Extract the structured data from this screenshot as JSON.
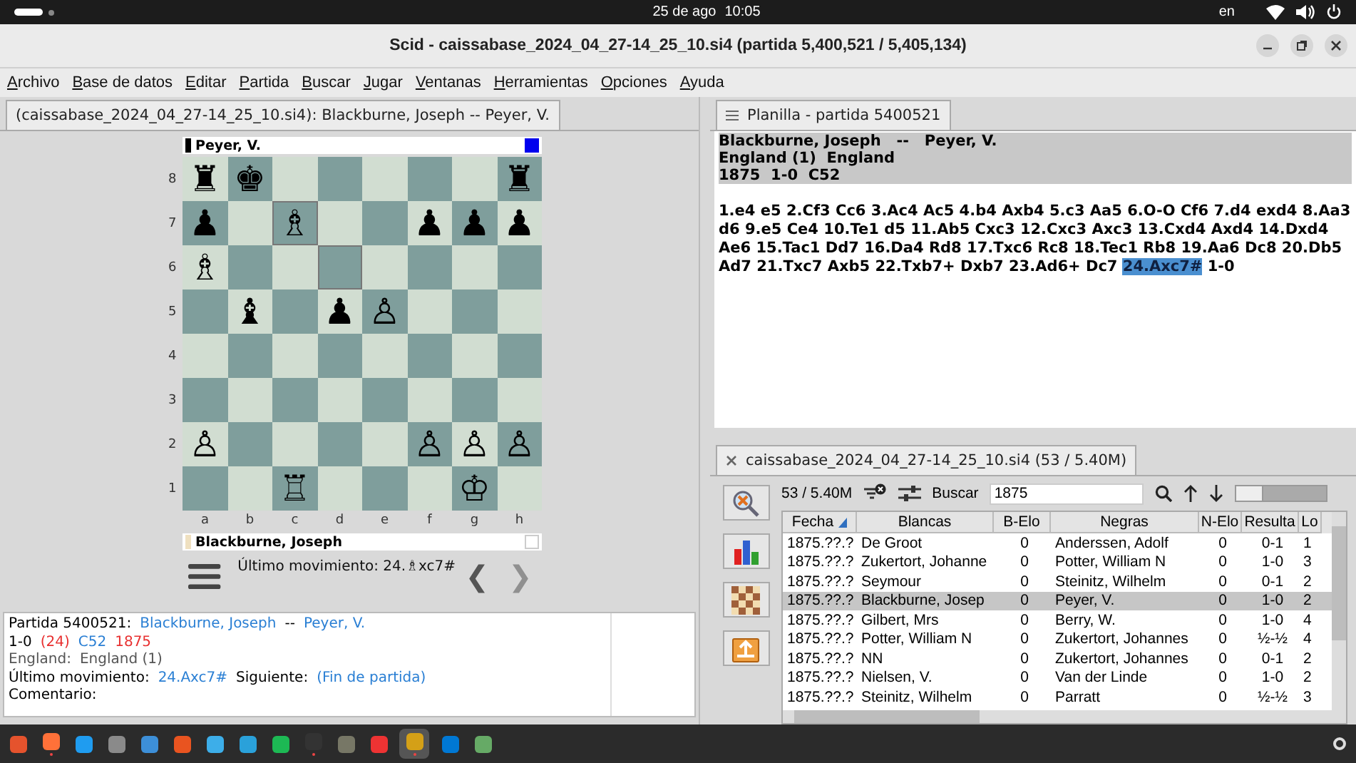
{
  "system_bar": {
    "date": "25 de ago",
    "time": "10:05",
    "language": "en"
  },
  "window": {
    "title": "Scid - caissabase_2024_04_27-14_25_10.si4 (partida 5,400,521 / 5,405,134)"
  },
  "menu": [
    "Archivo",
    "Base de datos",
    "Editar",
    "Partida",
    "Buscar",
    "Jugar",
    "Ventanas",
    "Herramientas",
    "Opciones",
    "Ayuda"
  ],
  "board_pane": {
    "tab": {
      "label": "(caissabase_2024_04_27-14_25_10.si4): Blackburne, Joseph -- Peyer, V.",
      "selected": true
    },
    "players": [
      {
        "name": "Peyer, V.",
        "color": "#000000",
        "to_move": true
      },
      {
        "name": "Blackburne, Joseph",
        "color": "#efe0c0",
        "to_move": false
      }
    ],
    "ranks": [
      {
        "label": "8",
        "squares": [
          {
            "piece": "♜",
            "highlighted": false
          },
          {
            "piece": "♚",
            "highlighted": false
          },
          {
            "highlighted": false
          },
          {
            "highlighted": false
          },
          {
            "highlighted": false
          },
          {
            "highlighted": false
          },
          {
            "highlighted": false
          },
          {
            "piece": "♜",
            "highlighted": false
          }
        ]
      },
      {
        "label": "7",
        "squares": [
          {
            "piece": "♟",
            "highlighted": false
          },
          {
            "highlighted": false
          },
          {
            "piece": "♗",
            "highlighted": true
          },
          {
            "highlighted": false
          },
          {
            "highlighted": false
          },
          {
            "piece": "♟",
            "highlighted": false
          },
          {
            "piece": "♟",
            "highlighted": false
          },
          {
            "piece": "♟",
            "highlighted": false
          }
        ]
      },
      {
        "label": "6",
        "squares": [
          {
            "piece": "♗",
            "highlighted": false
          },
          {
            "highlighted": false
          },
          {
            "highlighted": false
          },
          {
            "highlighted": true
          },
          {
            "highlighted": false
          },
          {
            "highlighted": false
          },
          {
            "highlighted": false
          },
          {
            "highlighted": false
          }
        ]
      },
      {
        "label": "5",
        "squares": [
          {
            "highlighted": false
          },
          {
            "piece": "♝",
            "highlighted": false
          },
          {
            "highlighted": false
          },
          {
            "piece": "♟",
            "highlighted": false
          },
          {
            "piece": "♙",
            "highlighted": false
          },
          {
            "highlighted": false
          },
          {
            "highlighted": false
          },
          {
            "highlighted": false
          }
        ]
      },
      {
        "label": "4",
        "squares": [
          {
            "highlighted": false
          },
          {
            "highlighted": false
          },
          {
            "highlighted": false
          },
          {
            "highlighted": false
          },
          {
            "highlighted": false
          },
          {
            "highlighted": false
          },
          {
            "highlighted": false
          },
          {
            "highlighted": false
          }
        ]
      },
      {
        "label": "3",
        "squares": [
          {
            "highlighted": false
          },
          {
            "highlighted": false
          },
          {
            "highlighted": false
          },
          {
            "highlighted": false
          },
          {
            "highlighted": false
          },
          {
            "highlighted": false
          },
          {
            "highlighted": false
          },
          {
            "highlighted": false
          }
        ]
      },
      {
        "label": "2",
        "squares": [
          {
            "piece": "♙",
            "highlighted": false
          },
          {
            "highlighted": false
          },
          {
            "highlighted": false
          },
          {
            "highlighted": false
          },
          {
            "highlighted": false
          },
          {
            "piece": "♙",
            "highlighted": false
          },
          {
            "piece": "♙",
            "highlighted": false
          },
          {
            "piece": "♙",
            "highlighted": false
          }
        ]
      },
      {
        "label": "1",
        "squares": [
          {
            "highlighted": false
          },
          {
            "highlighted": false
          },
          {
            "piece": "♖",
            "highlighted": false
          },
          {
            "highlighted": false
          },
          {
            "highlighted": false
          },
          {
            "highlighted": false
          },
          {
            "piece": "♔",
            "highlighted": false
          },
          {
            "highlighted": false
          }
        ]
      }
    ],
    "files": [
      "a",
      "b",
      "c",
      "d",
      "e",
      "f",
      "g",
      "h"
    ],
    "last_move": "Último movimiento: 24.♗xc7#",
    "nav": [
      {
        "symbol": "❮",
        "disabled": false
      },
      {
        "symbol": "❯",
        "disabled": true
      }
    ]
  },
  "game_info": {
    "lines": [
      [
        {
          "text": "Partida 5400521:",
          "kind": "plain"
        },
        {
          "text": "Blackburne, Joseph",
          "kind": "link"
        },
        {
          "text": "--",
          "kind": "plain"
        },
        {
          "text": "Peyer, V.",
          "kind": "link"
        }
      ],
      [
        {
          "text": "1-0",
          "kind": "plain"
        },
        {
          "text": "(24)",
          "kind": "red"
        },
        {
          "text": "C52",
          "kind": "link"
        },
        {
          "text": "1875",
          "kind": "red"
        }
      ],
      [
        {
          "text": "England:",
          "kind": "muted"
        },
        {
          "text": "England (1)",
          "kind": "muted"
        }
      ],
      [
        {
          "text": "Último movimiento:",
          "kind": "plain"
        },
        {
          "text": "24.Axc7#",
          "kind": "link"
        },
        {
          "text": "Siguiente:",
          "kind": "plain"
        },
        {
          "text": "(Fin de partida)",
          "kind": "link"
        }
      ],
      [
        {
          "text": "Comentario:",
          "kind": "plain"
        }
      ]
    ]
  },
  "notation_pane": {
    "tab": {
      "label": "Planilla - partida 5400521",
      "selected": true
    },
    "header": [
      "Blackburne, Joseph   --   Peyer, V.",
      "England (1)  England",
      "1875  1-0  C52"
    ],
    "moves": [
      {
        "text": "1.e4 e5 2.Cf3 Cc6 3.Ac4 Ac5 4.b4 Axb4 5.c3 Aa5 6.O-O Cf6 7.d4 exd4 8.Aa3 d6 9.e5 Ce4 10.Te1 d5 11.Ab5 Cxc3 12.Cxc3 Axc3 13.Cxd4 Axd4 14.Dxd4 Ae6 15.Tac1 Dd7 16.Da4 Rd8 17.Txc6 Rc8 18.Tec1 Rb8 19.Aa6 Dc8 20.Db5 Ad7 21.Txc7 Axb5 22.Txb7+ Dxb7 23.Ad6+ Dc7",
        "current": false
      },
      {
        "text": "24.Axc7#",
        "current": true
      },
      {
        "text": "1-0",
        "current": false
      }
    ]
  },
  "games_pane": {
    "tab": {
      "label": "caissabase_2024_04_27-14_25_10.si4 (53 / 5.40M)",
      "selected": true
    },
    "count": "53 / 5.40M",
    "search": {
      "label": "Buscar",
      "value": "1875"
    },
    "columns": [
      {
        "label": "Fecha",
        "sorted": true
      },
      {
        "label": "Blancas",
        "sorted": false
      },
      {
        "label": "B-Elo",
        "sorted": false
      },
      {
        "label": "Negras",
        "sorted": false
      },
      {
        "label": "N-Elo",
        "sorted": false
      },
      {
        "label": "Resulta",
        "sorted": false
      },
      {
        "label": "Lo",
        "sorted": false
      }
    ],
    "rows": [
      {
        "cells": [
          "1875.??.?",
          "De Groot",
          "0",
          "Anderssen, Adolf",
          "0",
          "0-1",
          "1"
        ],
        "selected": false
      },
      {
        "cells": [
          "1875.??.?",
          "Zukertort, Johanne",
          "0",
          "Potter, William N",
          "0",
          "1-0",
          "3"
        ],
        "selected": false
      },
      {
        "cells": [
          "1875.??.?",
          "Seymour",
          "0",
          "Steinitz, Wilhelm",
          "0",
          "0-1",
          "2"
        ],
        "selected": false
      },
      {
        "cells": [
          "1875.??.?",
          "Blackburne, Josep",
          "0",
          "Peyer, V.",
          "0",
          "1-0",
          "2"
        ],
        "selected": true
      },
      {
        "cells": [
          "1875.??.?",
          "Gilbert, Mrs",
          "0",
          "Berry, W.",
          "0",
          "1-0",
          "4"
        ],
        "selected": false
      },
      {
        "cells": [
          "1875.??.?",
          "Potter, William N",
          "0",
          "Zukertort, Johannes",
          "0",
          "½-½",
          "4"
        ],
        "selected": false
      },
      {
        "cells": [
          "1875.??.?",
          "NN",
          "0",
          "Zukertort, Johannes",
          "0",
          "0-1",
          "2"
        ],
        "selected": false
      },
      {
        "cells": [
          "1875.??.?",
          "Nielsen, V.",
          "0",
          "Van der Linde",
          "0",
          "1-0",
          "2"
        ],
        "selected": false
      },
      {
        "cells": [
          "1875.??.?",
          "Steinitz, Wilhelm",
          "0",
          "Parratt",
          "0",
          "½-½",
          "3"
        ],
        "selected": false
      }
    ]
  },
  "taskbar": {
    "apps": [
      {
        "running": false,
        "active": false
      },
      {
        "running": true,
        "active": false
      },
      {
        "running": false,
        "active": false
      },
      {
        "running": false,
        "active": false
      },
      {
        "running": false,
        "active": false
      },
      {
        "running": false,
        "active": false
      },
      {
        "running": false,
        "active": false
      },
      {
        "running": false,
        "active": false
      },
      {
        "running": false,
        "active": false
      },
      {
        "running": true,
        "active": false
      },
      {
        "running": false,
        "active": false
      },
      {
        "running": false,
        "active": false
      },
      {
        "running": true,
        "active": true
      },
      {
        "running": false,
        "active": false
      },
      {
        "running": false,
        "active": false
      }
    ]
  }
}
